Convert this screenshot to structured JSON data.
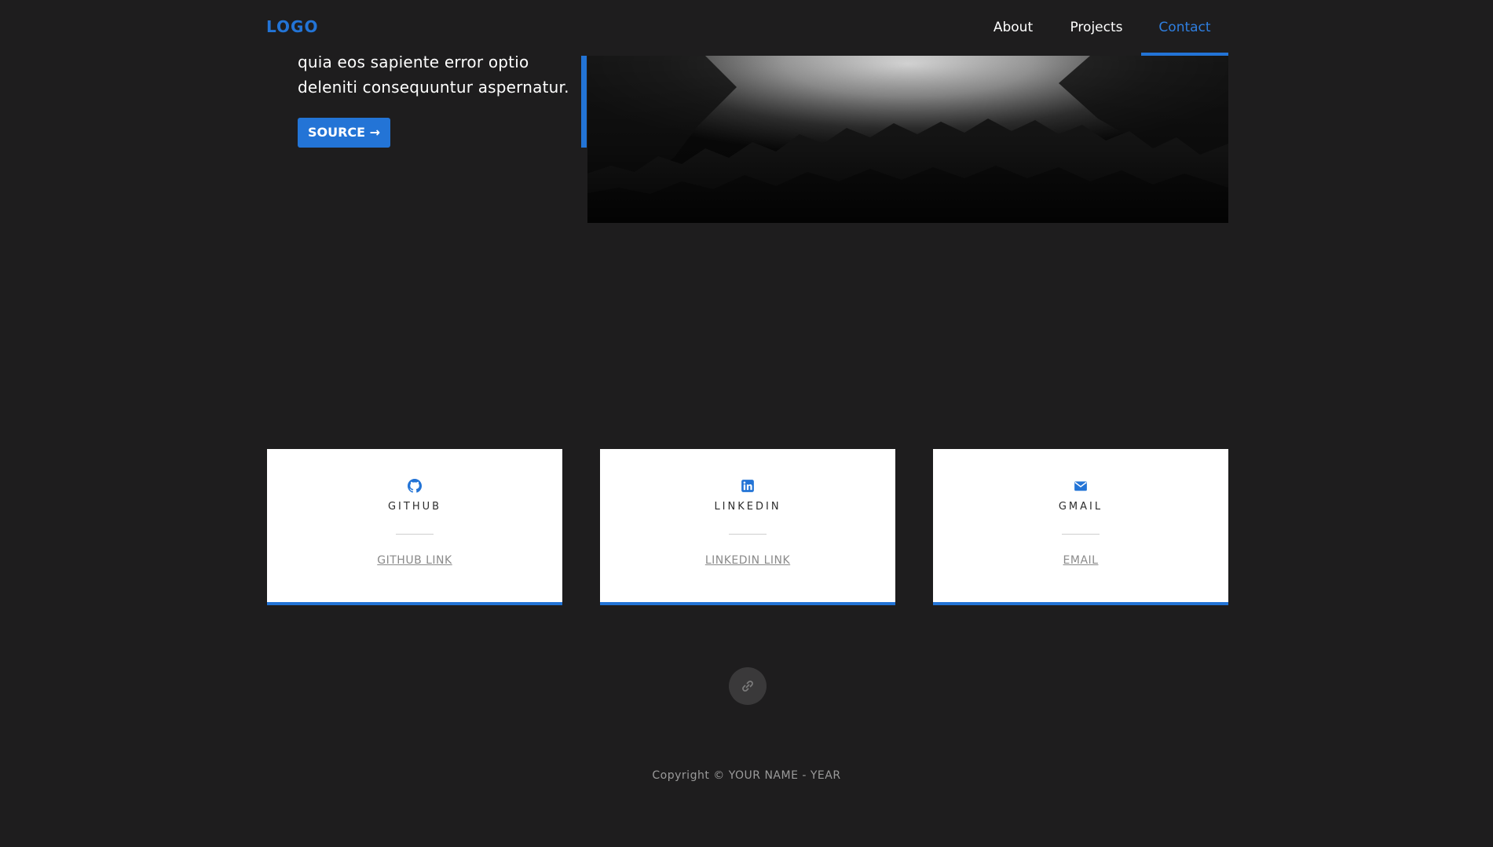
{
  "header": {
    "logo": "LOGO",
    "nav": [
      {
        "label": "About",
        "active": false
      },
      {
        "label": "Projects",
        "active": false
      },
      {
        "label": "Contact",
        "active": true
      }
    ]
  },
  "project": {
    "description_lines": [
      "quia eos sapiente error optio",
      "deleniti consequuntur aspernatur."
    ],
    "source_button": "SOURCE →",
    "image": "misty-forest-image"
  },
  "contact_cards": [
    {
      "icon": "github-icon",
      "title": "GITHUB",
      "link": "GITHUB LINK"
    },
    {
      "icon": "linkedin-icon",
      "title": "LINKEDIN",
      "link": "LINKEDIN LINK"
    },
    {
      "icon": "envelope-icon",
      "title": "GMAIL",
      "link": "EMAIL"
    }
  ],
  "link_button_icon": "link-icon",
  "footer": {
    "copyright": "Copyright © YOUR NAME - YEAR"
  },
  "colors": {
    "accent": "#2374d6",
    "background": "#1e1d1e",
    "card_background": "#ffffff"
  }
}
